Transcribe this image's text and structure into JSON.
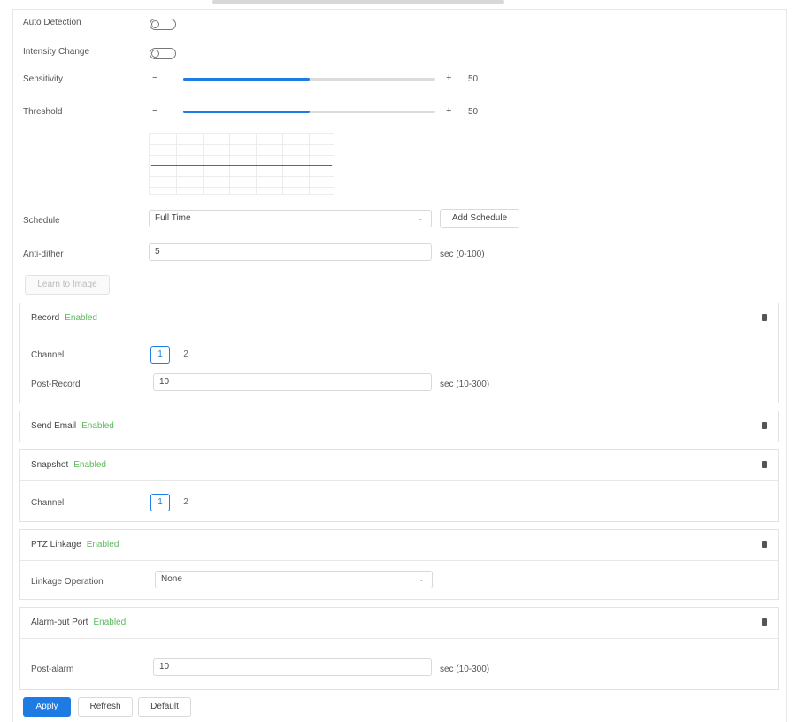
{
  "form": {
    "auto_detection_label": "Auto Detection",
    "intensity_change_label": "Intensity Change",
    "sensitivity": {
      "label": "Sensitivity",
      "value": 50,
      "value_text": "50",
      "minus": "−",
      "plus": "+"
    },
    "threshold": {
      "label": "Threshold",
      "value": 50,
      "value_text": "50",
      "minus": "−",
      "plus": "+"
    },
    "schedule": {
      "label": "Schedule",
      "value": "Full Time",
      "add_label": "Add Schedule"
    },
    "anti_dither": {
      "label": "Anti-dither",
      "value": "5",
      "hint": "sec (0-100)"
    },
    "learn_button": "Learn to Image"
  },
  "record": {
    "title": "Record",
    "status": "Enabled",
    "channel_label": "Channel",
    "channels": [
      "1",
      "2"
    ],
    "post_record_label": "Post-Record",
    "post_record_value": "10",
    "post_record_hint": "sec (10-300)"
  },
  "send_email": {
    "title": "Send Email",
    "status": "Enabled"
  },
  "snapshot": {
    "title": "Snapshot",
    "status": "Enabled",
    "channel_label": "Channel",
    "channels": [
      "1",
      "2"
    ]
  },
  "ptz_linkage": {
    "title": "PTZ Linkage",
    "status": "Enabled",
    "operation_label": "Linkage Operation",
    "operation_value": "None"
  },
  "alarm_out": {
    "title": "Alarm-out Port",
    "status": "Enabled",
    "post_alarm_label": "Post-alarm",
    "post_alarm_value": "10",
    "post_alarm_hint": "sec (10-300)"
  },
  "footer": {
    "apply": "Apply",
    "refresh": "Refresh",
    "default": "Default"
  },
  "colors": {
    "accent": "#1e7be4",
    "enabled": "#5cb85c"
  }
}
